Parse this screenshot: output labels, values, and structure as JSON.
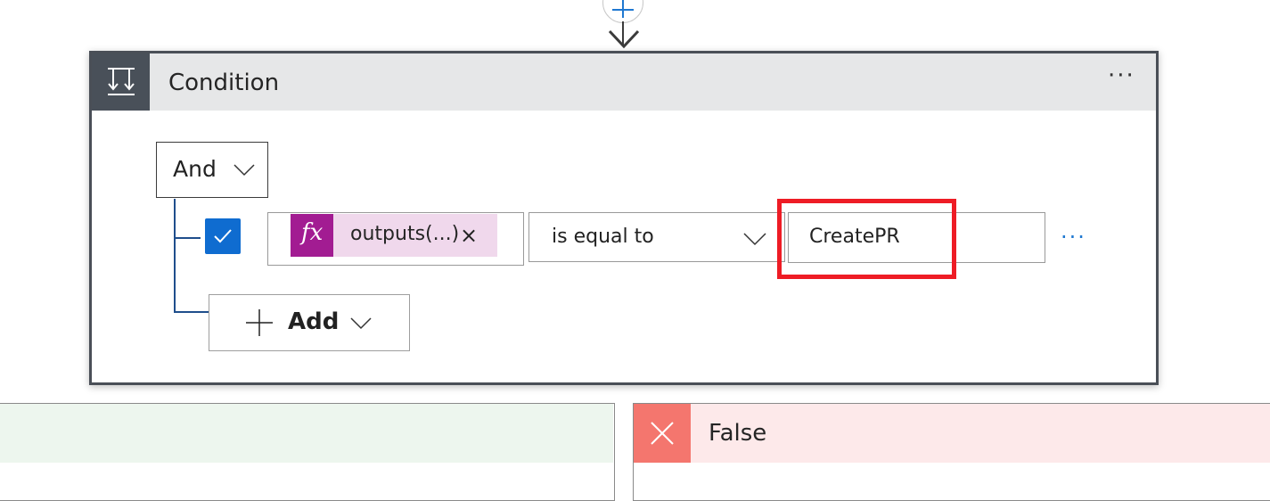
{
  "condition": {
    "title": "Condition",
    "menu": "···",
    "group_operator": "And",
    "row": {
      "checked": true,
      "left_operand": "outputs(...)",
      "remove_glyph": "×",
      "operator": "is equal to",
      "right_operand": "CreatePR",
      "menu": "···"
    },
    "add_label": "Add"
  },
  "branches": {
    "false_label": "False"
  },
  "colors": {
    "accent": "#0f6cd0",
    "expression_token": "#a21c92",
    "highlight": "#ee1c25",
    "true_branch": "#edf6ee",
    "false_branch": "#fde9ea"
  },
  "icons": [
    "plus-icon",
    "down-arrow-icon",
    "condition-icon",
    "chevron-down-icon",
    "checkmark-icon",
    "fx-icon",
    "close-icon"
  ]
}
